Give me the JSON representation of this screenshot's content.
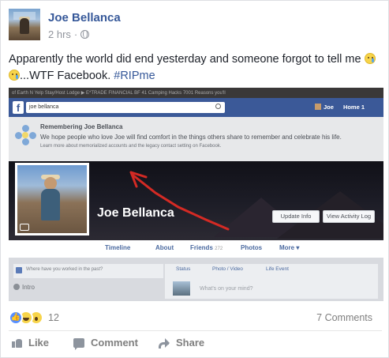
{
  "post": {
    "author": "Joe Bellanca",
    "time": "2 hrs",
    "separator": "·",
    "text_part1": "Apparently the world did end yesterday and someone forgot to tell me ",
    "text_part2": "...WTF Facebook. ",
    "hashtag": "#RIPme"
  },
  "screenshot": {
    "bookmarks": "of Earth    N Yelp    Stay/Host Lodge    ▶    E*TRADE FINANCIAL    BF 41 Camping Hacks    7001 Reasons you'll",
    "search_value": "joe bellanca",
    "nav_user": "Joe",
    "nav_home": "Home",
    "nav_count": "1",
    "memorial_title": "Remembering Joe Bellanca",
    "memorial_line": "We hope people who love Joe will find comfort in the things others share to remember and celebrate his life.",
    "memorial_learn": "Learn more about memorialized accounts and the legacy contact setting on Facebook.",
    "profile_name": "Joe Bellanca",
    "update_info": "Update Info",
    "view_activity": "View Activity Log",
    "tabs": {
      "timeline": "Timeline",
      "about": "About",
      "friends": "Friends",
      "friends_count": "272",
      "photos": "Photos",
      "more": "More ▾"
    },
    "worked_prompt": "Where have you worked in the past?",
    "composer": {
      "status": "Status",
      "photo_video": "Photo / Video",
      "life_event": "Life Event",
      "prompt": "What's on your mind?"
    },
    "intro": "Intro"
  },
  "footer": {
    "reaction_count": "12",
    "comments": "7 Comments",
    "like": "Like",
    "comment": "Comment",
    "share": "Share"
  },
  "colors": {
    "link": "#365899",
    "fb_blue": "#3b5998",
    "annotation_red": "#d42a24"
  }
}
